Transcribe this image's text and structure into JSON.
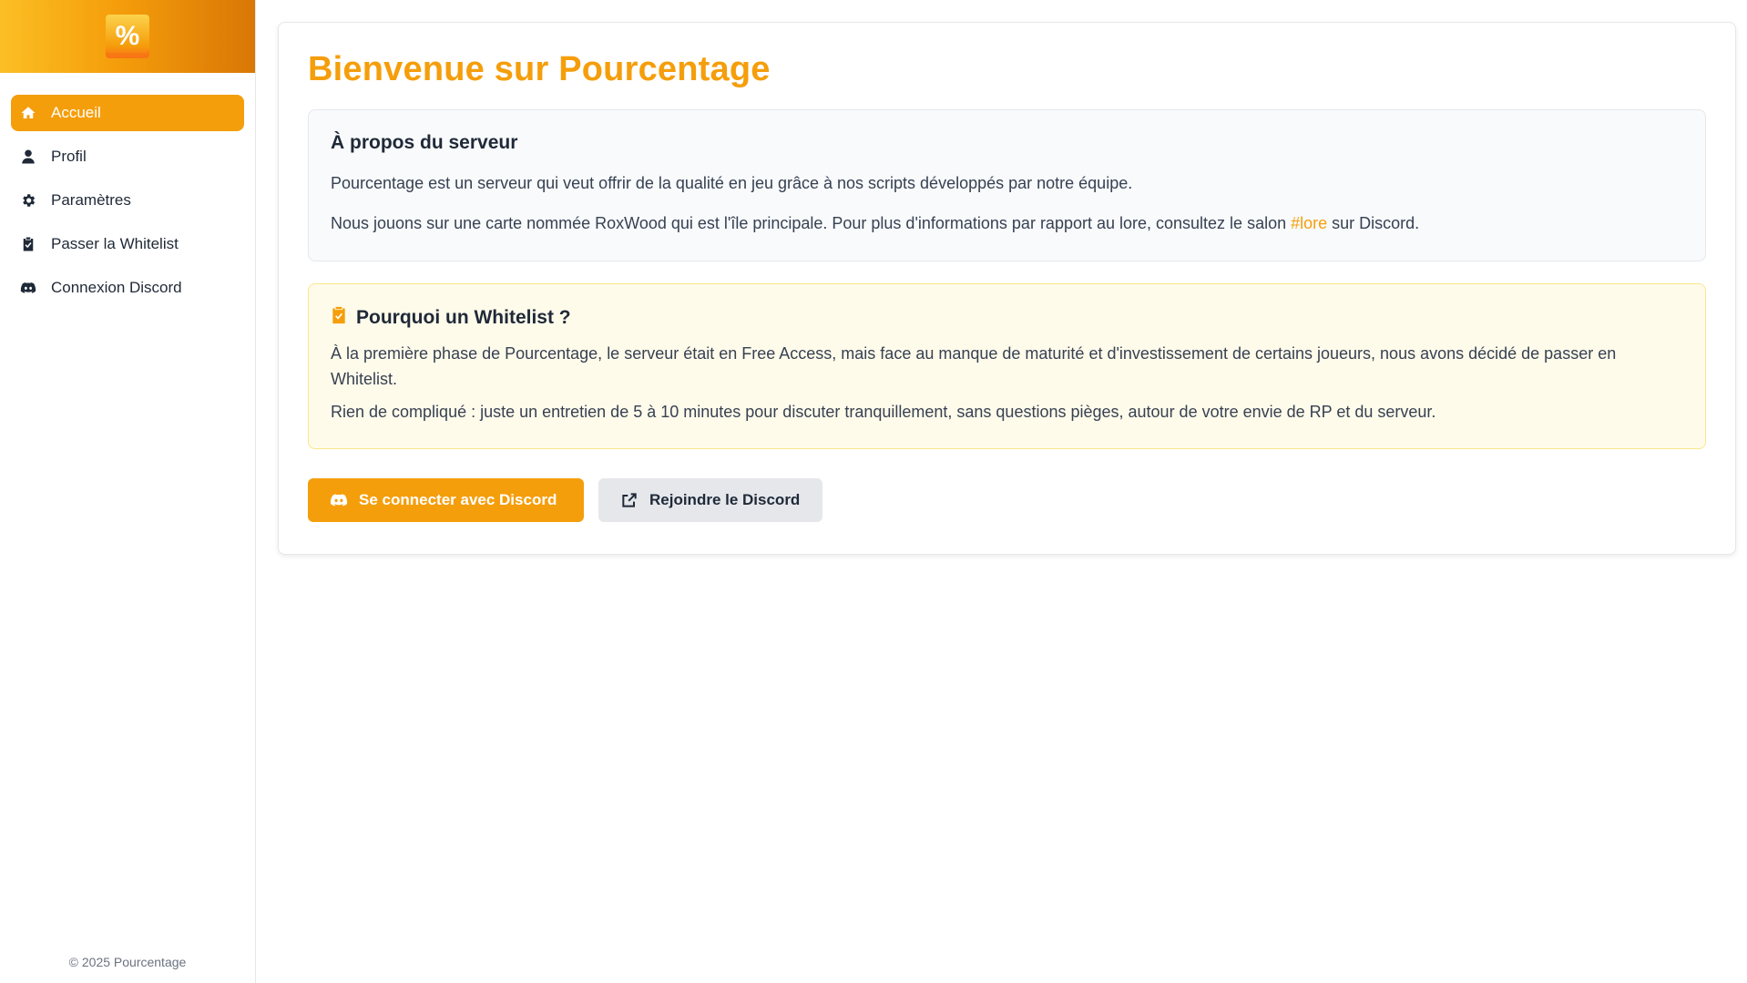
{
  "sidebar": {
    "logo_text": "%",
    "items": [
      {
        "label": "Accueil",
        "icon": "home-icon",
        "active": true
      },
      {
        "label": "Profil",
        "icon": "user-icon",
        "active": false
      },
      {
        "label": "Paramètres",
        "icon": "gear-icon",
        "active": false
      },
      {
        "label": "Passer la Whitelist",
        "icon": "clipboard-check-icon",
        "active": false
      },
      {
        "label": "Connexion Discord",
        "icon": "discord-icon",
        "active": false
      }
    ],
    "footer": "© 2025 Pourcentage"
  },
  "main": {
    "title": "Bienvenue sur Pourcentage",
    "about": {
      "title": "À propos du serveur",
      "paragraph1": "Pourcentage est un serveur qui veut offrir de la qualité en jeu grâce à nos scripts développés par notre équipe.",
      "paragraph2_before": "Nous jouons sur une carte nommée RoxWood qui est l'île principale. Pour plus d'informations par rapport au lore, consultez le salon ",
      "paragraph2_link": "#lore",
      "paragraph2_after": " sur Discord."
    },
    "whitelist": {
      "title": "Pourquoi un Whitelist ?",
      "paragraph1": "À la première phase de Pourcentage, le serveur était en Free Access, mais face au manque de maturité et d'investissement de certains joueurs, nous avons décidé de passer en Whitelist.",
      "paragraph2": "Rien de compliqué : juste un entretien de 5 à 10 minutes pour discuter tranquillement, sans questions pièges, autour de votre envie de RP et du serveur."
    },
    "buttons": {
      "connect_label": "Se connecter avec Discord",
      "join_label": "Rejoindre le Discord"
    }
  },
  "colors": {
    "accent": "#f59e0b",
    "sidebar_gradient_start": "#fbbf24",
    "sidebar_gradient_end": "#d97706",
    "warn_bg": "#fffbeb",
    "info_bg": "#f8fafc"
  }
}
